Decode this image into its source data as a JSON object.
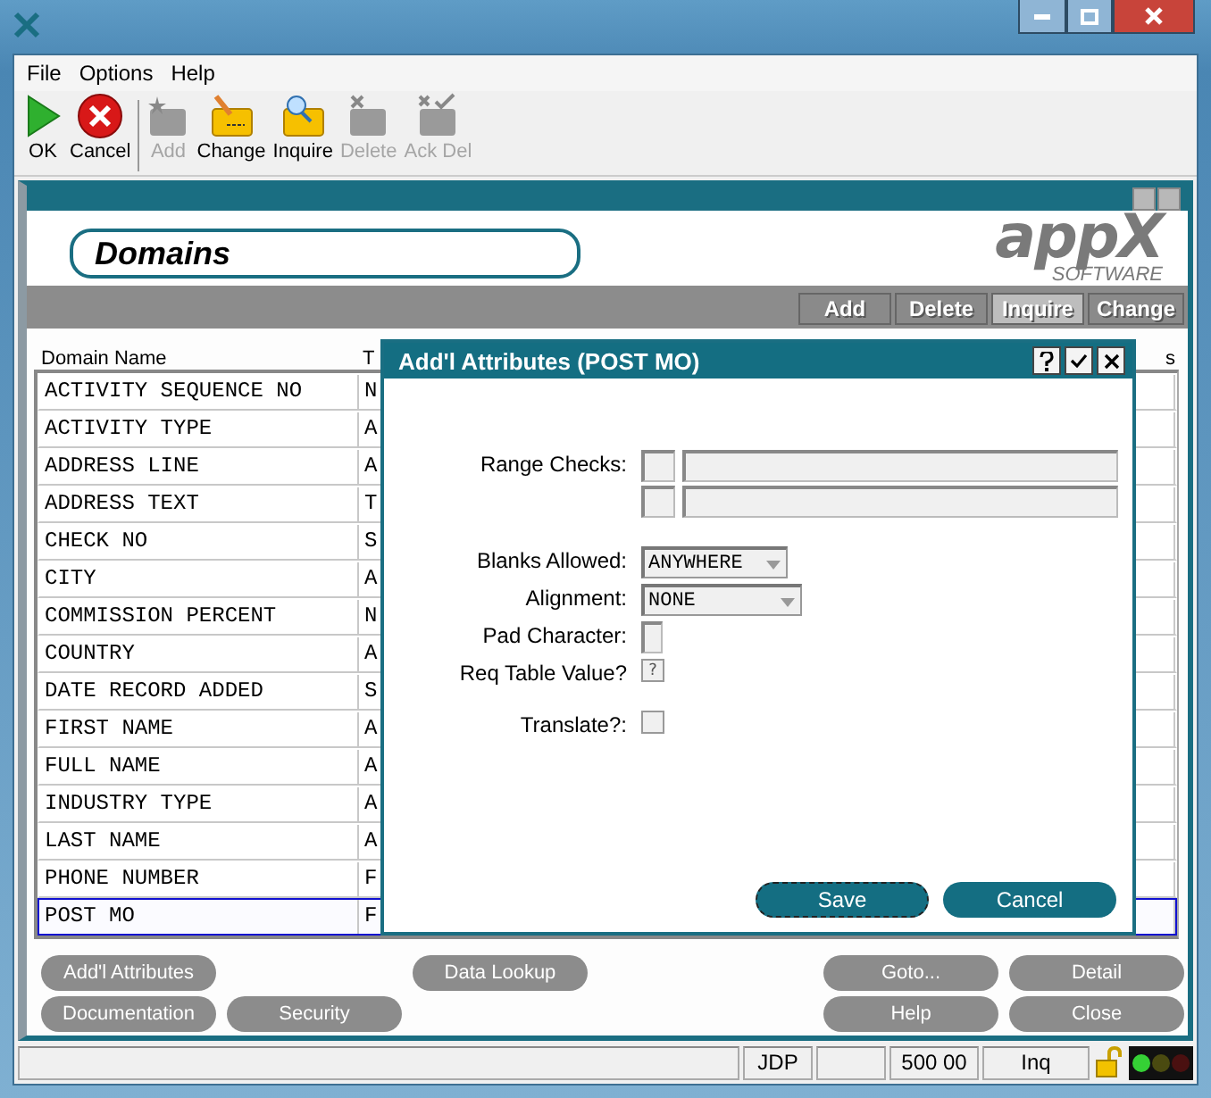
{
  "menu": [
    "File",
    "Options",
    "Help"
  ],
  "toolbar": [
    {
      "kind": "ok",
      "label": "OK",
      "disabled": false
    },
    {
      "kind": "cancel",
      "label": "Cancel",
      "disabled": false
    },
    {
      "kind": "add",
      "label": "Add",
      "disabled": true
    },
    {
      "kind": "change",
      "label": "Change",
      "disabled": false
    },
    {
      "kind": "inquire",
      "label": "Inquire",
      "disabled": false
    },
    {
      "kind": "delete",
      "label": "Delete",
      "disabled": true
    },
    {
      "kind": "ackdel",
      "label": "Ack Del",
      "disabled": true
    }
  ],
  "panel": {
    "title": "Domains",
    "logo": "appX",
    "logo_sub": "SOFTWARE",
    "actions": [
      {
        "label": "Add",
        "selected": false
      },
      {
        "label": "Delete",
        "selected": false
      },
      {
        "label": "Inquire",
        "selected": true
      },
      {
        "label": "Change",
        "selected": false
      }
    ]
  },
  "table": {
    "columns": [
      "Domain Name",
      "T",
      "s"
    ],
    "rows": [
      {
        "cells": [
          "ACTIVITY SEQUENCE NO",
          "N"
        ],
        "selected": false
      },
      {
        "cells": [
          "ACTIVITY TYPE",
          "A"
        ],
        "selected": false
      },
      {
        "cells": [
          "ADDRESS LINE",
          "A"
        ],
        "selected": false
      },
      {
        "cells": [
          "ADDRESS TEXT",
          "T"
        ],
        "selected": false
      },
      {
        "cells": [
          "CHECK NO",
          "S"
        ],
        "selected": false
      },
      {
        "cells": [
          "CITY",
          "A"
        ],
        "selected": false
      },
      {
        "cells": [
          "COMMISSION PERCENT",
          "N"
        ],
        "selected": false
      },
      {
        "cells": [
          "COUNTRY",
          "A"
        ],
        "selected": false
      },
      {
        "cells": [
          "DATE RECORD ADDED",
          "S"
        ],
        "selected": false
      },
      {
        "cells": [
          "FIRST NAME",
          "A"
        ],
        "selected": false
      },
      {
        "cells": [
          "FULL NAME",
          "A"
        ],
        "selected": false
      },
      {
        "cells": [
          "INDUSTRY TYPE",
          "A"
        ],
        "selected": false
      },
      {
        "cells": [
          "LAST NAME",
          "A"
        ],
        "selected": false
      },
      {
        "cells": [
          "PHONE NUMBER",
          "F"
        ],
        "selected": false
      },
      {
        "cells": [
          "POST MO",
          "F"
        ],
        "selected": true
      }
    ]
  },
  "dialog": {
    "title": "Add'l Attributes (POST MO)",
    "fields": [
      {
        "kind": "range",
        "label": "Range Checks:"
      },
      {
        "kind": "select",
        "label": "Blanks Allowed:",
        "value": "ANYWHERE"
      },
      {
        "kind": "select",
        "label": "Alignment:",
        "value": "NONE"
      },
      {
        "kind": "text",
        "label": "Pad Character:"
      },
      {
        "kind": "query",
        "label": "Req Table Value?",
        "value": "?"
      },
      {
        "kind": "check",
        "label": "Translate?:",
        "checked": false
      }
    ],
    "buttons": [
      {
        "label": "Save",
        "focused": true
      },
      {
        "label": "Cancel",
        "focused": false
      }
    ]
  },
  "bottom_buttons": [
    {
      "label": "Add'l Attributes"
    },
    {
      "label": "Data Lookup"
    },
    {
      "label": "Goto..."
    },
    {
      "label": "Detail"
    },
    {
      "label": "Documentation"
    },
    {
      "label": "Security"
    },
    {
      "label": "Help"
    },
    {
      "label": "Close"
    }
  ],
  "status_bar": [
    {
      "kind": "blank"
    },
    {
      "kind": "text",
      "text": "JDP"
    },
    {
      "kind": "blank"
    },
    {
      "kind": "text",
      "text": "500 00"
    },
    {
      "kind": "text",
      "text": "Inq"
    }
  ]
}
